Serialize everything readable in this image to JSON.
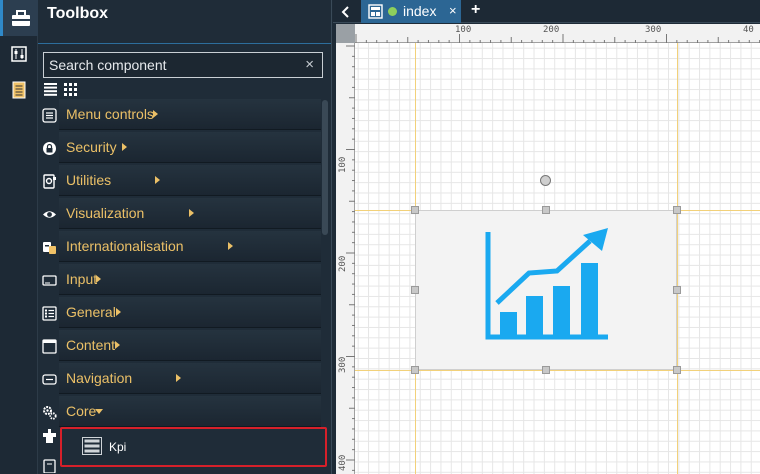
{
  "toolbox": {
    "title": "Toolbox",
    "search_placeholder": "Search component",
    "clear_symbol": "×",
    "categories": [
      {
        "label": "Menu controls",
        "icon": "menu-controls-icon",
        "expanded": false
      },
      {
        "label": "Security",
        "icon": "lock-icon",
        "expanded": false
      },
      {
        "label": "Utilities",
        "icon": "utilities-icon",
        "expanded": false
      },
      {
        "label": "Visualization",
        "icon": "eye-icon",
        "expanded": false
      },
      {
        "label": "Internationalisation",
        "icon": "internationalisation-icon",
        "expanded": false
      },
      {
        "label": "Input",
        "icon": "input-icon",
        "expanded": false
      },
      {
        "label": "General",
        "icon": "general-icon",
        "expanded": false
      },
      {
        "label": "Content",
        "icon": "content-icon",
        "expanded": false
      },
      {
        "label": "Navigation",
        "icon": "navigation-icon",
        "expanded": false
      },
      {
        "label": "Core",
        "icon": "gears-icon",
        "expanded": true
      }
    ],
    "selected_component": {
      "label": "Kpi",
      "icon": "kpi-list-icon"
    }
  },
  "tabs": {
    "back_symbol": "<",
    "active": {
      "label": "index",
      "close_symbol": "×"
    },
    "add_symbol": "+"
  },
  "canvas": {
    "ruler_top_labels": [
      "100",
      "200",
      "300",
      "40"
    ],
    "ruler_left_labels": [
      "100",
      "200",
      "300",
      "400"
    ],
    "widget": {
      "name": "Kpi",
      "icon": "kpi-chart-icon"
    }
  },
  "colors": {
    "accent": "#2f89c9",
    "category_text": "#ebc067",
    "kpi_blue": "#1aa9f0",
    "selection_red": "#d6202a",
    "guide_yellow": "#f2d17a"
  }
}
